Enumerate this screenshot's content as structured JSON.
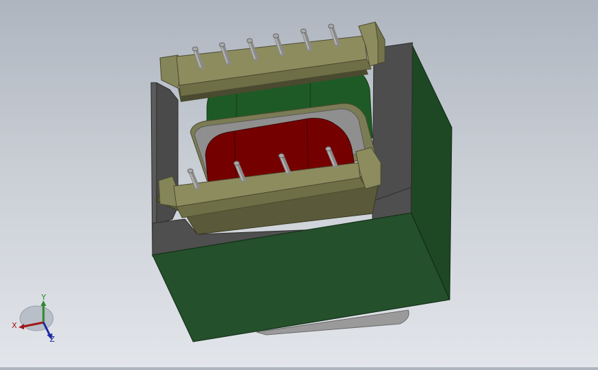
{
  "model": {
    "colors": {
      "background_top": "#aeb5bf",
      "background_bottom": "#e2e5ea",
      "core_green": "#214a28",
      "core_green_dark": "#173a1e",
      "core_gray": "#4b4b4b",
      "core_gray_light": "#5a5a5a",
      "bobbin_olive": "#8a8a5c",
      "bobbin_olive_dark": "#6e6e46",
      "coil_red": "#7a0000",
      "coil_green": "#1f5a26",
      "pin_gray": "#8c8c8c"
    },
    "pins_top_count": 6,
    "pins_bottom_count": 4
  },
  "triad": {
    "x_label": "X",
    "y_label": "Y",
    "z_label": "Z",
    "x_color": "#a01818",
    "y_color": "#2a8a2a",
    "z_color": "#1a2aa0"
  }
}
